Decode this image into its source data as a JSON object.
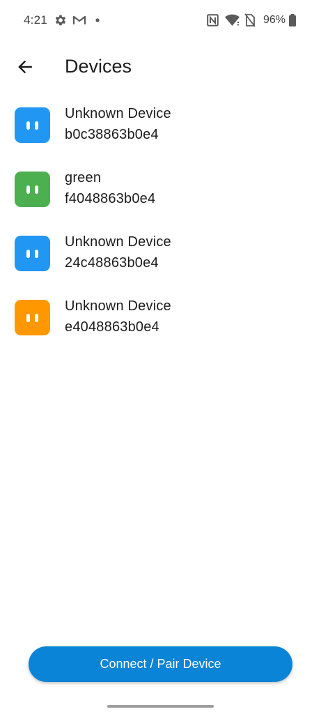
{
  "status_bar": {
    "time": "4:21",
    "battery": "96%",
    "icons_left": [
      "gear-icon",
      "gmail-icon",
      "dot-icon"
    ],
    "icons_right": [
      "nfc-icon",
      "wifi-icon",
      "no-sim-icon",
      "battery-icon"
    ]
  },
  "app_bar": {
    "title": "Devices",
    "back_icon": "arrow-back-icon"
  },
  "devices": [
    {
      "name": "Unknown Device",
      "id": "b0c38863b0e4",
      "color": "#2196F3"
    },
    {
      "name": "green",
      "id": "f4048863b0e4",
      "color": "#4CAF50"
    },
    {
      "name": "Unknown Device",
      "id": "24c48863b0e4",
      "color": "#2196F3"
    },
    {
      "name": "Unknown Device",
      "id": "e4048863b0e4",
      "color": "#FF9800"
    }
  ],
  "connect_button": {
    "label": "Connect / Pair Device",
    "color": "#0A84D6"
  }
}
